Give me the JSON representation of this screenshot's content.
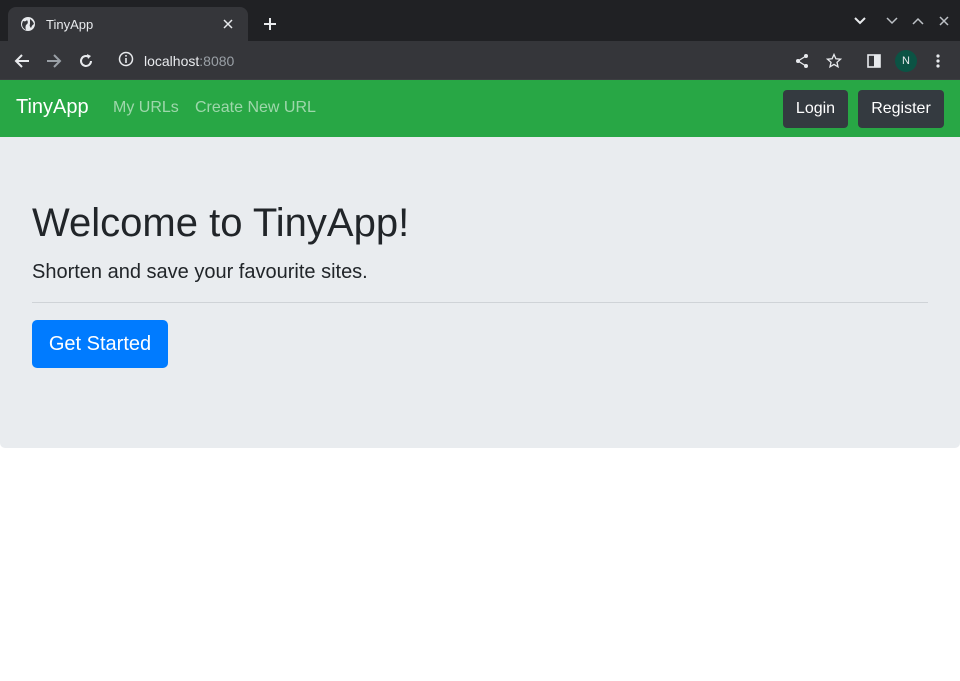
{
  "browser": {
    "tab_title": "TinyApp",
    "url_host": "localhost",
    "url_port": ":8080",
    "profile_initial": "N",
    "icons": [
      "globe-icon",
      "close-icon",
      "plus-icon",
      "back-icon",
      "forward-icon",
      "reload-icon",
      "info-icon",
      "share-icon",
      "star-icon",
      "side-panel-icon",
      "menu-icon"
    ]
  },
  "navbar": {
    "brand": "TinyApp",
    "links": [
      "My URLs",
      "Create New URL"
    ],
    "login": "Login",
    "register": "Register",
    "color": "#28a745"
  },
  "hero": {
    "heading": "Welcome to TinyApp!",
    "lead": "Shorten and save your favourite sites.",
    "cta": "Get Started",
    "cta_color": "#007bff"
  }
}
